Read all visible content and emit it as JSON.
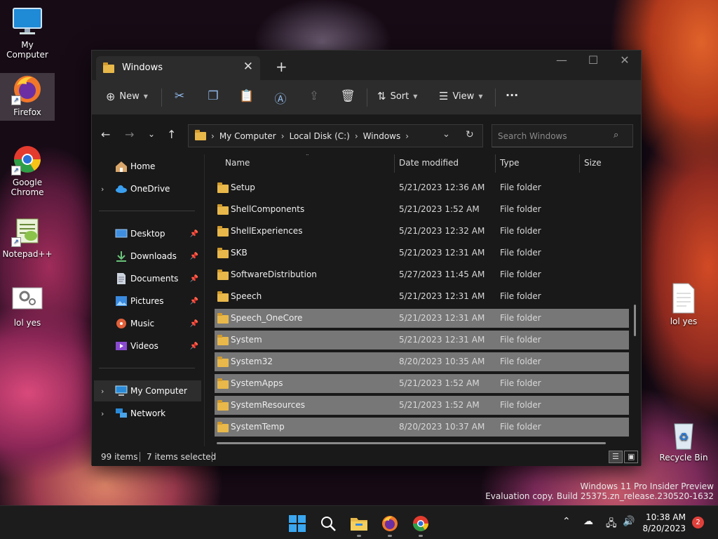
{
  "desktop": {
    "icons": [
      {
        "label": "My Computer"
      },
      {
        "label": "Firefox"
      },
      {
        "label": "Google Chrome"
      },
      {
        "label": "Notepad++"
      },
      {
        "label": "lol yes"
      },
      {
        "label": "lol yes"
      },
      {
        "label": "Recycle Bin"
      }
    ],
    "watermark": {
      "line1": "Windows 11 Pro Insider Preview",
      "line2": "Evaluation copy. Build 25375.zn_release.230520-1632"
    }
  },
  "window": {
    "tab_title": "Windows",
    "toolbar": {
      "new_label": "New",
      "sort_label": "Sort",
      "view_label": "View",
      "more_label": "···"
    },
    "breadcrumb": [
      "My Computer",
      "Local Disk (C:)",
      "Windows"
    ],
    "search": {
      "placeholder": "Search Windows"
    },
    "sidebar": {
      "home": "Home",
      "onedrive": "OneDrive",
      "quick": [
        {
          "label": "Desktop",
          "icon": "desktop-icon"
        },
        {
          "label": "Downloads",
          "icon": "downloads-icon"
        },
        {
          "label": "Documents",
          "icon": "documents-icon"
        },
        {
          "label": "Pictures",
          "icon": "pictures-icon"
        },
        {
          "label": "Music",
          "icon": "music-icon"
        },
        {
          "label": "Videos",
          "icon": "videos-icon"
        }
      ],
      "my_computer": "My Computer",
      "network": "Network"
    },
    "columns": {
      "name": "Name",
      "date": "Date modified",
      "type": "Type",
      "size": "Size"
    },
    "rows": [
      {
        "name": "Setup",
        "date": "5/21/2023 12:36 AM",
        "type": "File folder",
        "selected": false
      },
      {
        "name": "ShellComponents",
        "date": "5/21/2023 1:52 AM",
        "type": "File folder",
        "selected": false
      },
      {
        "name": "ShellExperiences",
        "date": "5/21/2023 12:32 AM",
        "type": "File folder",
        "selected": false
      },
      {
        "name": "SKB",
        "date": "5/21/2023 12:31 AM",
        "type": "File folder",
        "selected": false
      },
      {
        "name": "SoftwareDistribution",
        "date": "5/27/2023 11:45 AM",
        "type": "File folder",
        "selected": false
      },
      {
        "name": "Speech",
        "date": "5/21/2023 12:31 AM",
        "type": "File folder",
        "selected": false
      },
      {
        "name": "Speech_OneCore",
        "date": "5/21/2023 12:31 AM",
        "type": "File folder",
        "selected": true
      },
      {
        "name": "System",
        "date": "5/21/2023 12:31 AM",
        "type": "File folder",
        "selected": true
      },
      {
        "name": "System32",
        "date": "8/20/2023 10:35 AM",
        "type": "File folder",
        "selected": true
      },
      {
        "name": "SystemApps",
        "date": "5/21/2023 1:52 AM",
        "type": "File folder",
        "selected": true
      },
      {
        "name": "SystemResources",
        "date": "5/21/2023 1:52 AM",
        "type": "File folder",
        "selected": true
      },
      {
        "name": "SystemTemp",
        "date": "8/20/2023 10:37 AM",
        "type": "File folder",
        "selected": true
      }
    ],
    "status": {
      "count": "99 items",
      "selected": "7 items selected"
    }
  },
  "taskbar": {
    "time": "10:38 AM",
    "date": "8/20/2023",
    "notifications": "2"
  },
  "colors": {
    "selection": "#777777",
    "accent": "#8fb7e8",
    "folder": "#e8b84a"
  }
}
